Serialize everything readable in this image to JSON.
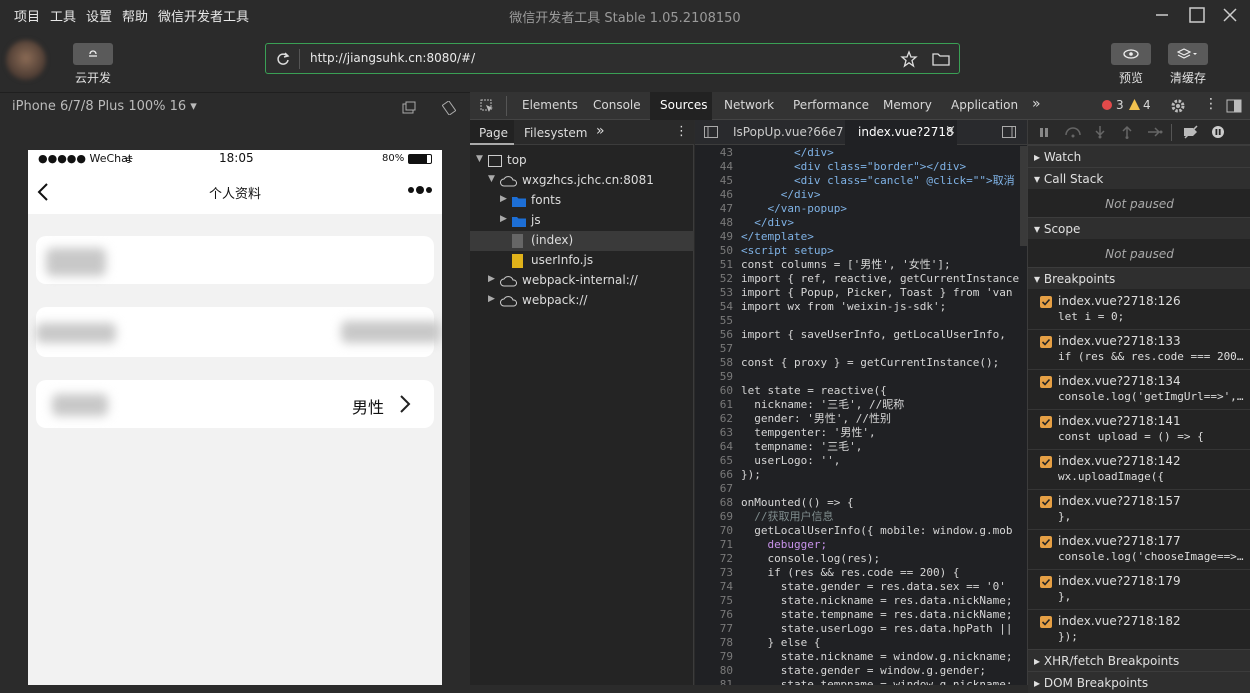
{
  "menu": [
    "项目",
    "工具",
    "设置",
    "帮助",
    "微信开发者工具"
  ],
  "app_title": "微信开发者工具 Stable 1.05.2108150",
  "toolbar": {
    "cloud_label": "云开发",
    "preview_label": "预览",
    "clear_cache_label": "清缓存",
    "url": "http://jiangsuhk.cn:8080/#/"
  },
  "simulator": {
    "device": "iPhone 6/7/8 Plus 100% 16 ▾",
    "status_carrier": "●●●●● WeChat",
    "status_time": "18:05",
    "status_battery": "80%",
    "nav_title": "个人资料",
    "gender_value": "男性"
  },
  "devtools": {
    "tabs": [
      "Elements",
      "Console",
      "Sources",
      "Network",
      "Performance",
      "Memory",
      "Application"
    ],
    "errors": "3",
    "warnings": "4"
  },
  "navigator": {
    "tabs": [
      "Page",
      "Filesystem"
    ],
    "tree": [
      {
        "label": "top",
        "level": 0,
        "icon": "frame"
      },
      {
        "label": "wxgzhcs.jchc.cn:8081",
        "level": 1,
        "icon": "cloud"
      },
      {
        "label": "fonts",
        "level": 2,
        "icon": "folder"
      },
      {
        "label": "js",
        "level": 2,
        "icon": "folder"
      },
      {
        "label": "(index)",
        "level": 2,
        "icon": "file-gray"
      },
      {
        "label": "userInfo.js",
        "level": 2,
        "icon": "file-yellow"
      },
      {
        "label": "webpack-internal://",
        "level": 1,
        "icon": "cloud"
      },
      {
        "label": "webpack://",
        "level": 1,
        "icon": "cloud"
      }
    ]
  },
  "editor": {
    "tabs": [
      "IsPopUp.vue?66e7",
      "index.vue?2718"
    ],
    "lines": [
      {
        "n": "43",
        "t": "        </div>"
      },
      {
        "n": "44",
        "t": "        <div class=\"border\"></div>"
      },
      {
        "n": "45",
        "t": "        <div class=\"cancle\" @click=\"\">取消"
      },
      {
        "n": "46",
        "t": "      </div>"
      },
      {
        "n": "47",
        "t": "    </van-popup>"
      },
      {
        "n": "48",
        "t": "  </div>"
      },
      {
        "n": "49",
        "t": "</template>"
      },
      {
        "n": "50",
        "t": "<script setup>"
      },
      {
        "n": "51",
        "t": "const columns = ['男性', '女性'];"
      },
      {
        "n": "52",
        "t": "import { ref, reactive, getCurrentInstance"
      },
      {
        "n": "53",
        "t": "import { Popup, Picker, Toast } from 'van"
      },
      {
        "n": "54",
        "t": "import wx from 'weixin-js-sdk';"
      },
      {
        "n": "55",
        "t": ""
      },
      {
        "n": "56",
        "t": "import { saveUserInfo, getLocalUserInfo,"
      },
      {
        "n": "57",
        "t": ""
      },
      {
        "n": "58",
        "t": "const { proxy } = getCurrentInstance();"
      },
      {
        "n": "59",
        "t": ""
      },
      {
        "n": "60",
        "t": "let state = reactive({"
      },
      {
        "n": "61",
        "t": "  nickname: '三毛', //昵称"
      },
      {
        "n": "62",
        "t": "  gender: '男性', //性别"
      },
      {
        "n": "63",
        "t": "  tempgenter: '男性',"
      },
      {
        "n": "64",
        "t": "  tempname: '三毛',"
      },
      {
        "n": "65",
        "t": "  userLogo: '',"
      },
      {
        "n": "66",
        "t": "});"
      },
      {
        "n": "67",
        "t": ""
      },
      {
        "n": "68",
        "t": "onMounted(() => {"
      },
      {
        "n": "69",
        "t": "  //获取用户信息"
      },
      {
        "n": "70",
        "t": "  getLocalUserInfo({ mobile: window.g.mob"
      },
      {
        "n": "71",
        "t": "    debugger;"
      },
      {
        "n": "72",
        "t": "    console.log(res);"
      },
      {
        "n": "73",
        "t": "    if (res && res.code == 200) {"
      },
      {
        "n": "74",
        "t": "      state.gender = res.data.sex == '0'"
      },
      {
        "n": "75",
        "t": "      state.nickname = res.data.nickName;"
      },
      {
        "n": "76",
        "t": "      state.tempname = res.data.nickName;"
      },
      {
        "n": "77",
        "t": "      state.userLogo = res.data.hpPath ||"
      },
      {
        "n": "78",
        "t": "    } else {"
      },
      {
        "n": "79",
        "t": "      state.nickname = window.g.nickname;"
      },
      {
        "n": "80",
        "t": "      state.gender = window.g.gender;"
      },
      {
        "n": "81",
        "t": "      state.tempname = window.g.nickname;"
      }
    ]
  },
  "debugger": {
    "watch": "Watch",
    "call_stack": "Call Stack",
    "not_paused": "Not paused",
    "scope": "Scope",
    "breakpoints_label": "Breakpoints",
    "breakpoints": [
      {
        "file": "index.vue?2718:126",
        "code": "let i = 0;"
      },
      {
        "file": "index.vue?2718:133",
        "code": "if (res && res.code === 200..."
      },
      {
        "file": "index.vue?2718:134",
        "code": "console.log('getImgUrl==>',..."
      },
      {
        "file": "index.vue?2718:141",
        "code": "const upload = () => {"
      },
      {
        "file": "index.vue?2718:142",
        "code": "wx.uploadImage({"
      },
      {
        "file": "index.vue?2718:157",
        "code": "},"
      },
      {
        "file": "index.vue?2718:177",
        "code": "console.log('chooseImage==>..."
      },
      {
        "file": "index.vue?2718:179",
        "code": "},"
      },
      {
        "file": "index.vue?2718:182",
        "code": "});"
      }
    ],
    "xhr": "XHR/fetch Breakpoints",
    "dom": "DOM Breakpoints"
  }
}
